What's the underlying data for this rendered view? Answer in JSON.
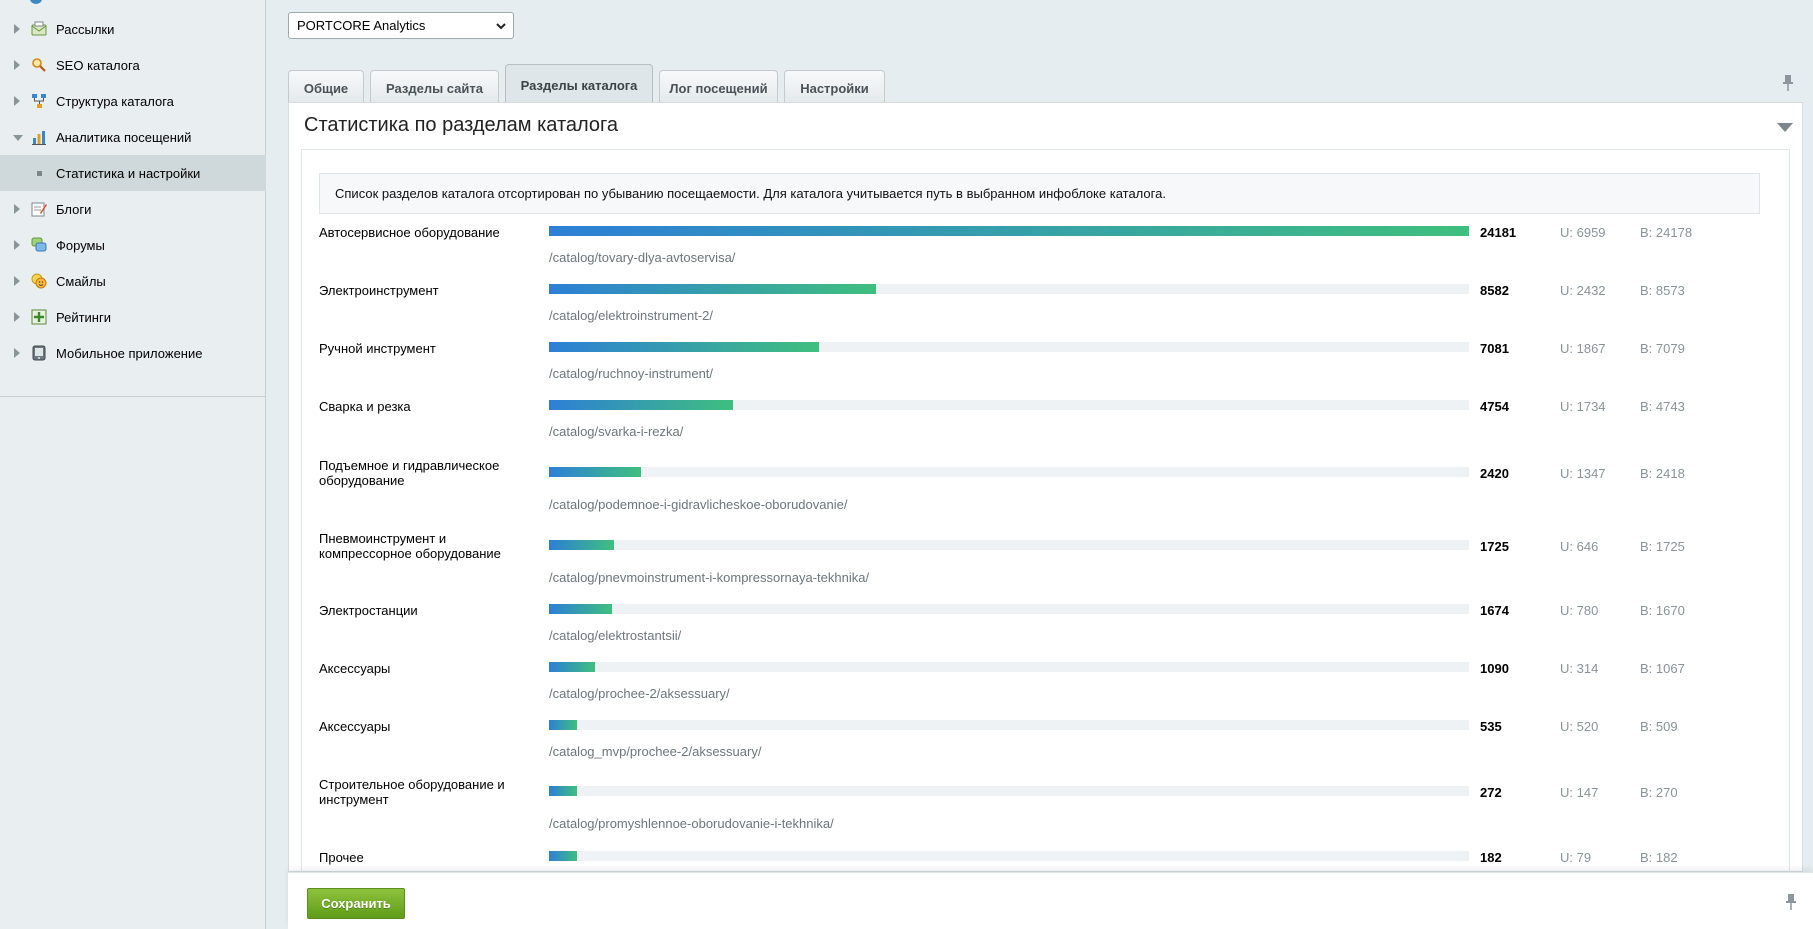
{
  "sidebar": {
    "items": [
      {
        "label": "Рассылки",
        "icon": "mail-icon",
        "expanded": false
      },
      {
        "label": "SEO каталога",
        "icon": "seo-search-icon",
        "expanded": false
      },
      {
        "label": "Структура каталога",
        "icon": "structure-icon",
        "expanded": false
      },
      {
        "label": "Аналитика посещений",
        "icon": "analytics-chart-icon",
        "expanded": true
      },
      {
        "label": "Статистика и настройки",
        "sub": true
      },
      {
        "label": "Блоги",
        "icon": "blog-icon",
        "expanded": false
      },
      {
        "label": "Форумы",
        "icon": "forum-icon",
        "expanded": false
      },
      {
        "label": "Смайлы",
        "icon": "smiley-icon",
        "expanded": false
      },
      {
        "label": "Рейтинги",
        "icon": "rating-icon",
        "expanded": false
      },
      {
        "label": "Мобильное приложение",
        "icon": "mobile-app-icon",
        "expanded": false
      }
    ]
  },
  "site_select": {
    "value": "PORTCORE Analytics"
  },
  "tabs": [
    {
      "label": "Общие",
      "active": false
    },
    {
      "label": "Разделы сайта",
      "active": false
    },
    {
      "label": "Разделы каталога",
      "active": true
    },
    {
      "label": "Лог посещений",
      "active": false
    },
    {
      "label": "Настройки",
      "active": false
    }
  ],
  "panel": {
    "title": "Статистика по разделам каталога",
    "note": "Список разделов каталога отсортирован по убыванию посещаемости. Для каталога учитывается путь в выбранном инфоблоке каталога."
  },
  "sections": [
    {
      "name": "Автосервисное оборудование",
      "path": "/catalog/tovary-dlya-avtoservisa/",
      "total": "24181",
      "users": "U: 6959",
      "visits": "B: 24178",
      "ratio": 1.0
    },
    {
      "name": "Электроинструмент",
      "path": "/catalog/elektroinstrument-2/",
      "total": "8582",
      "users": "U: 2432",
      "visits": "B: 8573",
      "ratio": 0.355
    },
    {
      "name": "Ручной инструмент",
      "path": "/catalog/ruchnoy-instrument/",
      "total": "7081",
      "users": "U: 1867",
      "visits": "B: 7079",
      "ratio": 0.293
    },
    {
      "name": "Сварка и резка",
      "path": "/catalog/svarka-i-rezka/",
      "total": "4754",
      "users": "U: 1734",
      "visits": "B: 4743",
      "ratio": 0.2
    },
    {
      "name": "Подъемное и гидравлическое оборудование",
      "path": "/catalog/podemnoe-i-gidravlicheskoe-oborudovanie/",
      "total": "2420",
      "users": "U: 1347",
      "visits": "B: 2418",
      "ratio": 0.1
    },
    {
      "name": "Пневмоинструмент и компрессорное оборудование",
      "path": "/catalog/pnevmoinstrument-i-kompressornaya-tekhnika/",
      "total": "1725",
      "users": "U: 646",
      "visits": "B: 1725",
      "ratio": 0.071
    },
    {
      "name": "Электростанции",
      "path": "/catalog/elektrostantsii/",
      "total": "1674",
      "users": "U: 780",
      "visits": "B: 1670",
      "ratio": 0.069
    },
    {
      "name": "Аксессуары",
      "path": "/catalog/prochee-2/aksessuary/",
      "total": "1090",
      "users": "U: 314",
      "visits": "B: 1067",
      "ratio": 0.05
    },
    {
      "name": "Аксессуары",
      "path": "/catalog_mvp/prochee-2/aksessuary/",
      "total": "535",
      "users": "U: 520",
      "visits": "B: 509",
      "ratio": 0.03
    },
    {
      "name": "Строительное оборудование и инструмент",
      "path": "/catalog/promyshlennoe-oborudovanie-i-tekhnika/",
      "total": "272",
      "users": "U: 147",
      "visits": "B: 270",
      "ratio": 0.03
    },
    {
      "name": "Прочее",
      "path": "",
      "total": "182",
      "users": "U: 79",
      "visits": "B: 182",
      "ratio": 0.03
    }
  ],
  "footer": {
    "save_label": "Сохранить"
  },
  "colors": {
    "bar_start": "#2d7fd6",
    "bar_end": "#3fbf7e",
    "save_button": "#6aa81f"
  }
}
